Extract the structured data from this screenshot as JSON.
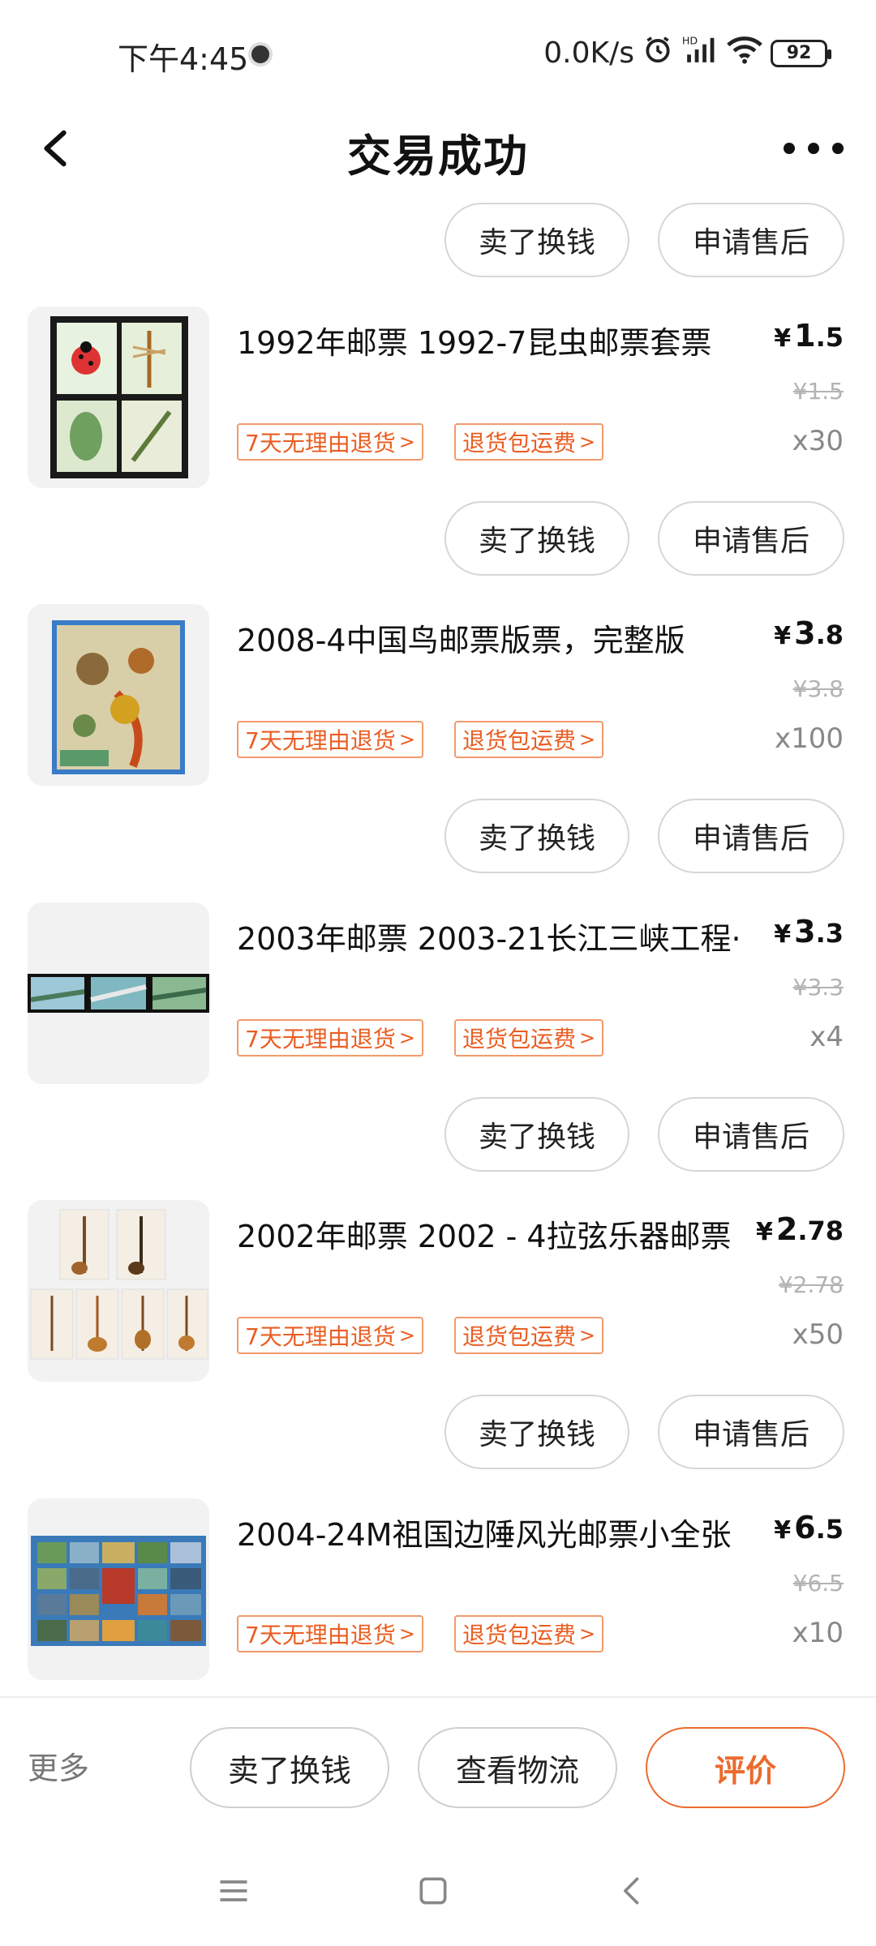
{
  "status_bar": {
    "time": "下午4:45",
    "network_speed": "0.0K/s",
    "battery": "92",
    "icons": [
      "alarm-icon",
      "signal-icon",
      "wifi-icon",
      "battery-icon"
    ]
  },
  "header": {
    "title": "交易成功"
  },
  "actions": {
    "sell": "卖了换钱",
    "after_sale": "申请售后"
  },
  "items": [
    {
      "title": "1992年邮票 1992-7昆虫邮票套票",
      "price_int": "1",
      "price_dec": ".5",
      "original_price": "1.5",
      "quantity": "x30",
      "tag_return": "7天无理由退货",
      "tag_shipping": "退货包运费"
    },
    {
      "title": "2008-4中国鸟邮票版票，完整版",
      "price_int": "3",
      "price_dec": ".8",
      "original_price": "3.8",
      "quantity": "x100",
      "tag_return": "7天无理由退货",
      "tag_shipping": "退货包运费"
    },
    {
      "title": "2003年邮票 2003-21长江三峡工程·",
      "price_int": "3",
      "price_dec": ".3",
      "original_price": "3.3",
      "quantity": "x4",
      "tag_return": "7天无理由退货",
      "tag_shipping": "退货包运费"
    },
    {
      "title": "2002年邮票 2002 - 4拉弦乐器邮票",
      "price_int": "2",
      "price_dec": ".78",
      "original_price": "2.78",
      "quantity": "x50",
      "tag_return": "7天无理由退货",
      "tag_shipping": "退货包运费"
    },
    {
      "title": "2004-24M祖国边陲风光邮票小全张",
      "price_int": "6",
      "price_dec": ".5",
      "original_price": "6.5",
      "quantity": "x10",
      "tag_return": "7天无理由退货",
      "tag_shipping": "退货包运费"
    }
  ],
  "currency": "¥",
  "bottom_bar": {
    "more": "更多",
    "sell": "卖了换钱",
    "logistics": "查看物流",
    "review": "评价"
  },
  "colors": {
    "accent": "#ec6a2d",
    "tag_text": "#ea5d22",
    "tag_border": "#f19a6c"
  }
}
